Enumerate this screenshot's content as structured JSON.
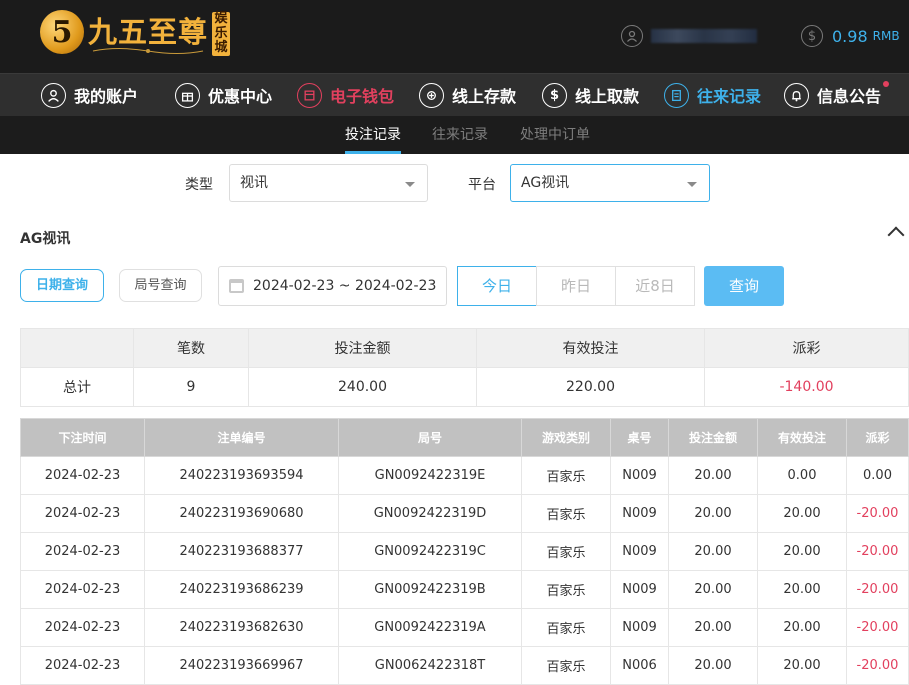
{
  "logo": {
    "mark": "5",
    "text": "九五至尊",
    "badge": "娱乐城"
  },
  "user": {
    "icon": "user-icon"
  },
  "balance": {
    "icon": "dollar-icon",
    "symbol": "$",
    "amount": "0.98",
    "unit": "RMB"
  },
  "nav": {
    "items": [
      {
        "label": "我的账户",
        "icon": "user-icon",
        "glyph": "👤"
      },
      {
        "label": "优惠中心",
        "icon": "gift-icon",
        "glyph": "🎁"
      },
      {
        "label": "电子钱包",
        "icon": "wallet-icon",
        "glyph": "▤"
      },
      {
        "label": "线上存款",
        "icon": "deposit-icon",
        "glyph": "⊕"
      },
      {
        "label": "线上取款",
        "icon": "withdraw-icon",
        "glyph": "$"
      },
      {
        "label": "往来记录",
        "icon": "record-icon",
        "glyph": "▦"
      },
      {
        "label": "信息公告",
        "icon": "bell-icon",
        "glyph": "🔔"
      }
    ],
    "accent_colors": {
      "wallet": "#e2405e",
      "record": "#3eb1ea"
    }
  },
  "subnav": {
    "tabs": [
      "投注记录",
      "往来记录",
      "处理中订单"
    ]
  },
  "filters": {
    "type_label": "类型",
    "type_value": "视讯",
    "platform_label": "平台",
    "platform_value": "AG视讯"
  },
  "section": {
    "title": "AG视讯"
  },
  "query": {
    "mode_date": "日期查询",
    "mode_round": "局号查询",
    "date_range": "2024-02-23 ~ 2024-02-23",
    "today": "今日",
    "yesterday": "昨日",
    "last8": "近8日",
    "submit": "查询"
  },
  "summary": {
    "headers": [
      "",
      "笔数",
      "投注金额",
      "有效投注",
      "派彩"
    ],
    "row": {
      "label": "总计",
      "count": "9",
      "bet": "240.00",
      "valid": "220.00",
      "payout": "-140.00"
    }
  },
  "records": {
    "headers": [
      "下注时间",
      "注单编号",
      "局号",
      "游戏类别",
      "桌号",
      "投注金额",
      "有效投注",
      "派彩"
    ],
    "rows": [
      [
        "2024-02-23",
        "240223193693594",
        "GN0092422319E",
        "百家乐",
        "N009",
        "20.00",
        "0.00",
        "0.00"
      ],
      [
        "2024-02-23",
        "240223193690680",
        "GN0092422319D",
        "百家乐",
        "N009",
        "20.00",
        "20.00",
        "-20.00"
      ],
      [
        "2024-02-23",
        "240223193688377",
        "GN0092422319C",
        "百家乐",
        "N009",
        "20.00",
        "20.00",
        "-20.00"
      ],
      [
        "2024-02-23",
        "240223193686239",
        "GN0092422319B",
        "百家乐",
        "N009",
        "20.00",
        "20.00",
        "-20.00"
      ],
      [
        "2024-02-23",
        "240223193682630",
        "GN0092422319A",
        "百家乐",
        "N009",
        "20.00",
        "20.00",
        "-20.00"
      ],
      [
        "2024-02-23",
        "240223193669967",
        "GN0062422318T",
        "百家乐",
        "N006",
        "20.00",
        "20.00",
        "-20.00"
      ]
    ]
  },
  "colors": {
    "accent": "#3eb1ea",
    "negative": "#e2405e",
    "header_bg": "#1b1b1b",
    "nav_bg": "#2f2f2f"
  }
}
